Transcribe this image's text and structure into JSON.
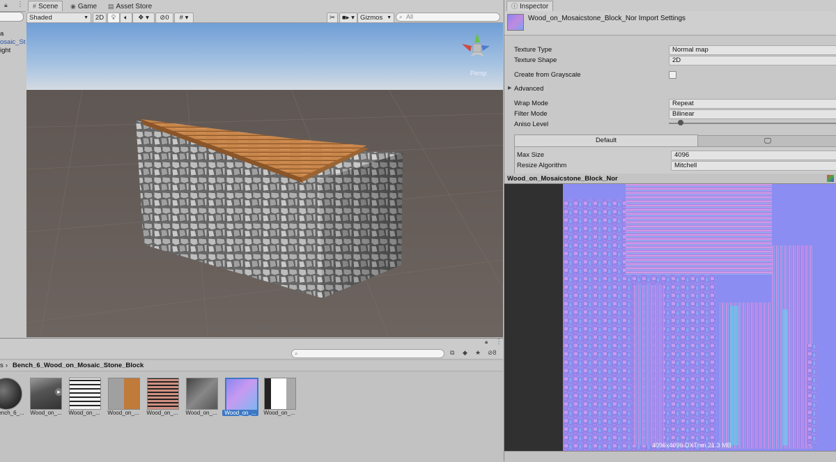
{
  "hierarchy": {
    "items": [
      "a",
      "osaic_Sto",
      "ight"
    ]
  },
  "scene": {
    "tabs": [
      "Scene",
      "Game",
      "Asset Store"
    ],
    "shading_mode": "Shaded",
    "mode_2d": "2D",
    "hidden_count": "0",
    "gizmos_label": "Gizmos",
    "search_placeholder": "All",
    "camera_label": "Persp"
  },
  "inspector": {
    "tab": "Inspector",
    "title": "Wood_on_Mosaicstone_Block_Nor Import Settings",
    "props": [
      {
        "label": "Texture Type",
        "value": "Normal map"
      },
      {
        "label": "Texture Shape",
        "value": "2D"
      },
      {
        "label": "Create from Grayscale",
        "value": ""
      },
      {
        "label": "Advanced",
        "value": ""
      },
      {
        "label": "Wrap Mode",
        "value": "Repeat"
      },
      {
        "label": "Filter Mode",
        "value": "Bilinear"
      },
      {
        "label": "Aniso Level",
        "value": ""
      }
    ],
    "platform_tab": "Default",
    "max_size_label": "Max Size",
    "max_size_value": "4096",
    "resize_label": "Resize Algorithm",
    "resize_value": "Mitchell",
    "preview_title": "Wood_on_Mosaicstone_Block_Nor",
    "preview_info": "4096x4096  DXTnm  21.3 MB"
  },
  "project": {
    "breadcrumb_prefix": "s",
    "breadcrumb": "Bench_6_Wood_on_Mosaic_Stone_Block",
    "hidden_count": "8",
    "assets": [
      {
        "label": "ench_6_...",
        "selected": false
      },
      {
        "label": "Wood_on_...",
        "selected": false
      },
      {
        "label": "Wood_on_...",
        "selected": false
      },
      {
        "label": "Wood_on_...",
        "selected": false
      },
      {
        "label": "Wood_on_...",
        "selected": false
      },
      {
        "label": "Wood_on_...",
        "selected": false
      },
      {
        "label": "Wood_on_...",
        "selected": true
      },
      {
        "label": "Wood_on_...",
        "selected": false
      }
    ]
  },
  "icons": [
    "lock-icon",
    "menu-icon",
    "light-icon",
    "audio-icon",
    "effects-icon",
    "visibility-icon",
    "grid-icon",
    "tools-icon",
    "camera-icon",
    "monitor-icon",
    "search-icon",
    "star-icon",
    "label-icon"
  ]
}
